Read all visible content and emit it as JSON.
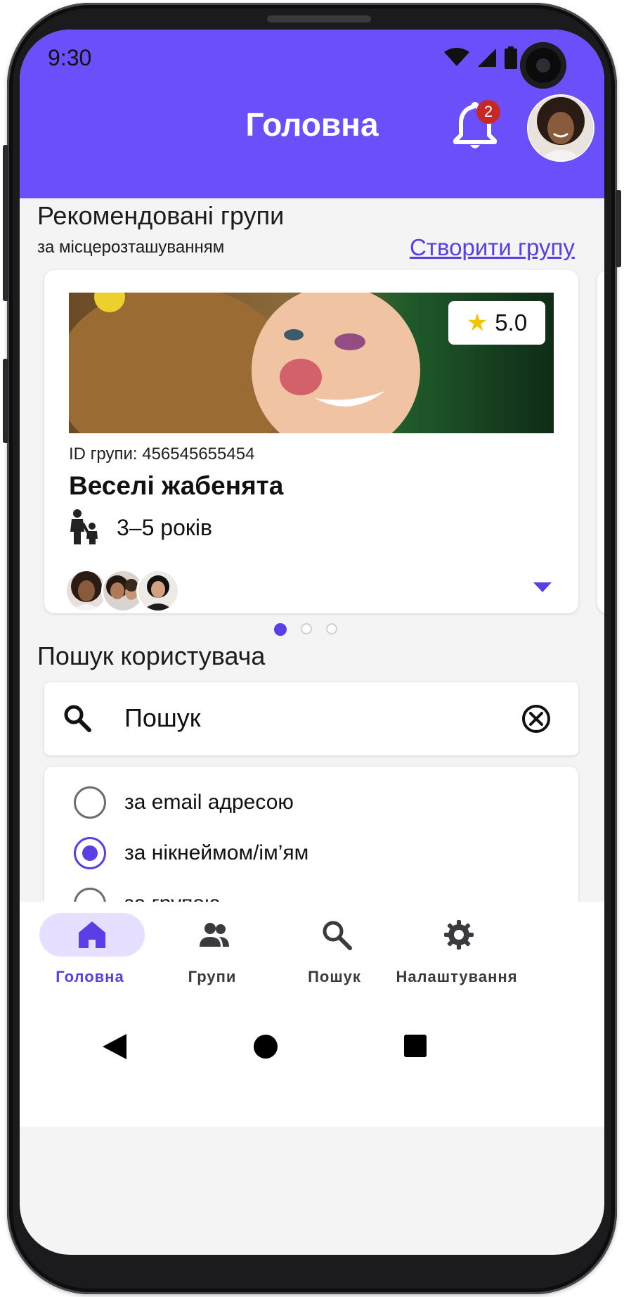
{
  "status_bar": {
    "time": "9:30"
  },
  "header": {
    "title": "Головна",
    "notification_count": "2",
    "accent_color": "#6a4ffb"
  },
  "recommended": {
    "title": "Рекомендовані групи",
    "subtitle": "за місцерозташуванням",
    "create_link": "Створити групу"
  },
  "group_card": {
    "rating": "5.0",
    "group_id": "ID групи: 456545655454",
    "name": "Веселі жабенята",
    "age": "3–5 років",
    "members": [
      "avatar-1",
      "avatar-2",
      "avatar-3"
    ]
  },
  "carousel": {
    "pages": 3,
    "active_index": 0
  },
  "user_search": {
    "title": "Пошук користувача",
    "query": "Пошук",
    "options": [
      {
        "label": "за email адресою",
        "checked": false
      },
      {
        "label": "за нікнеймом/ім’ям",
        "checked": true
      },
      {
        "label": "за групою",
        "checked": false
      }
    ]
  },
  "bottom_nav": {
    "items": [
      {
        "label": "Головна",
        "icon": "home-icon",
        "active": true
      },
      {
        "label": "Групи",
        "icon": "groups-icon",
        "active": false
      },
      {
        "label": "Пошук",
        "icon": "search-icon",
        "active": false
      },
      {
        "label": "Налаштування",
        "icon": "gear-icon",
        "active": false
      }
    ]
  },
  "system_nav": {
    "icons": [
      "back-icon",
      "home-circle-icon",
      "recents-icon"
    ]
  }
}
